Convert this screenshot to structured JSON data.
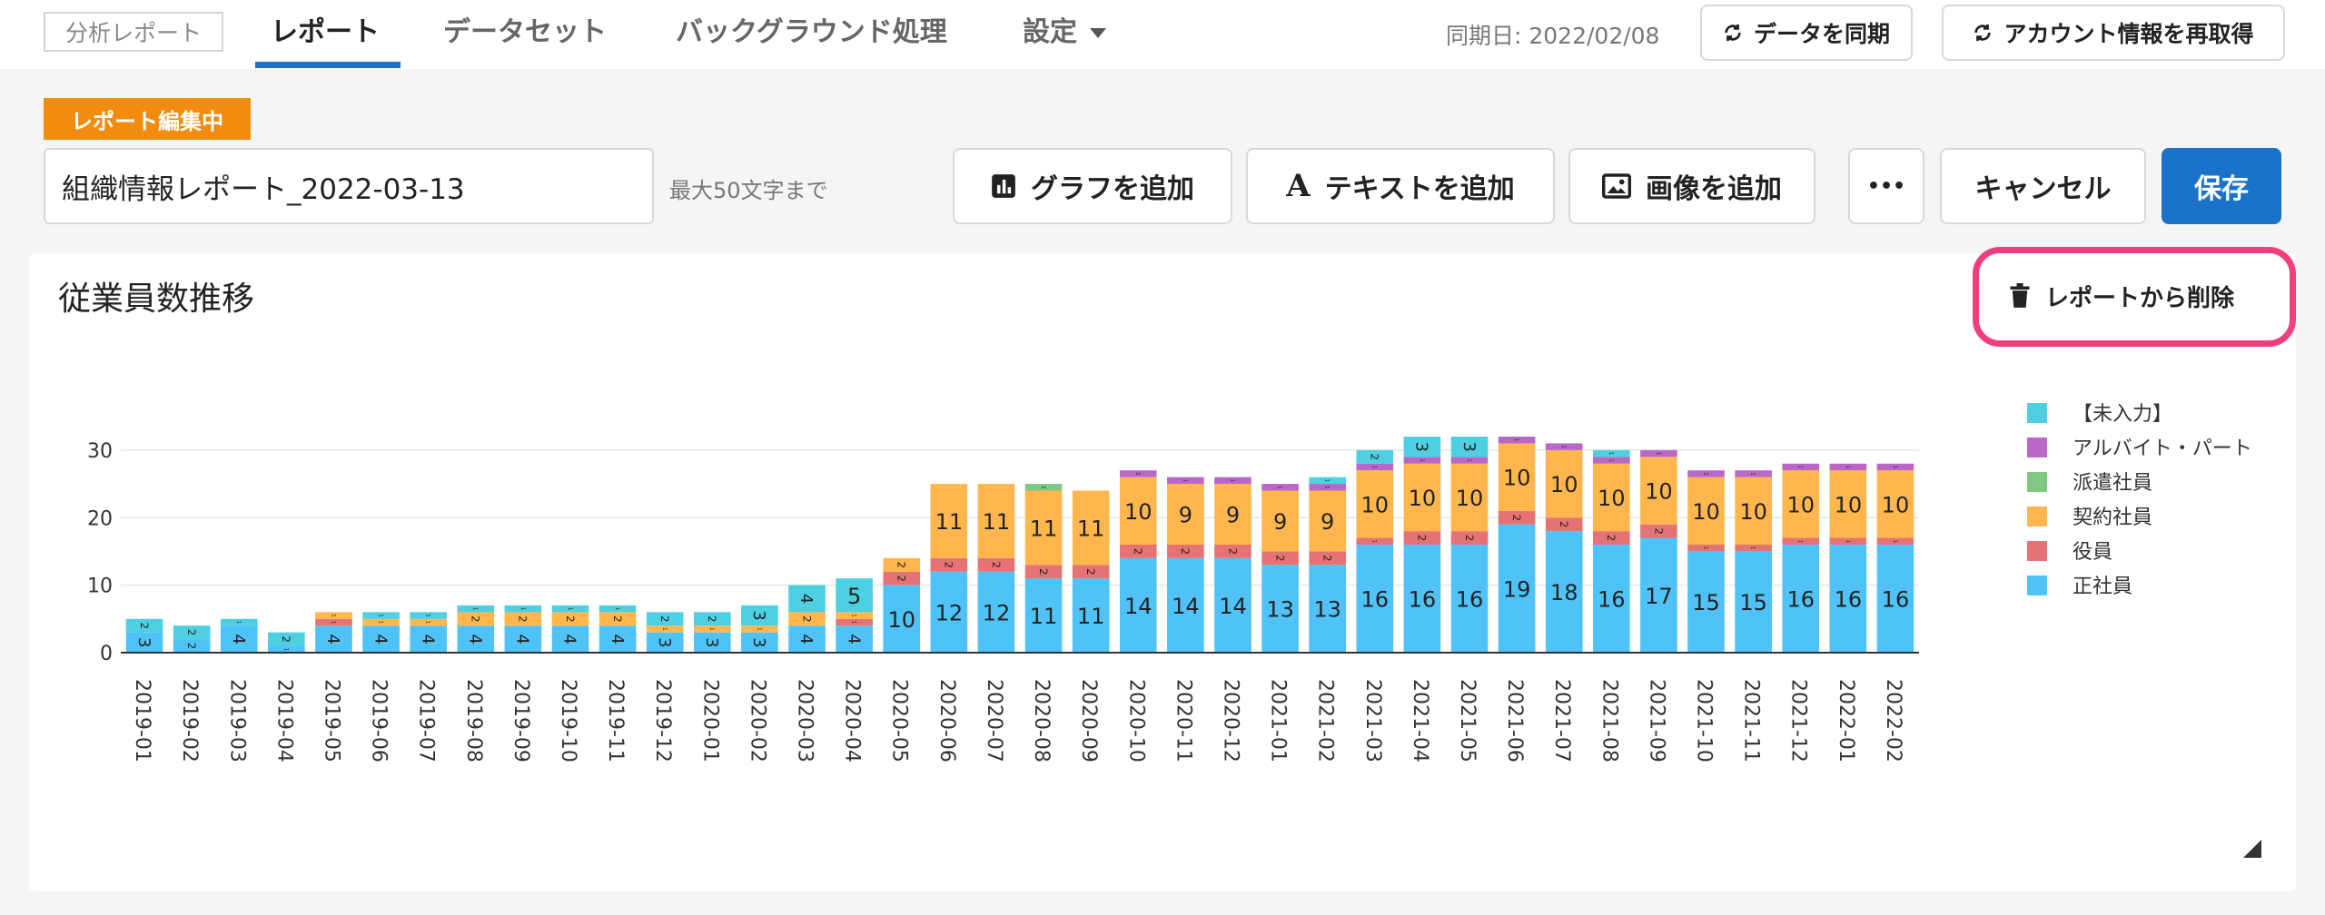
{
  "topbar": {
    "brand": "分析レポート",
    "tabs": [
      "レポート",
      "データセット",
      "バックグラウンド処理",
      "設定"
    ],
    "sync_date": "同期日: 2022/02/08",
    "sync_button": "データを同期",
    "reacquire_button": "アカウント情報を再取得"
  },
  "editor": {
    "badge": "レポート編集中",
    "title_value": "組織情報レポート_2022-03-13",
    "hint": "最大50文字まで",
    "add_graph": "グラフを追加",
    "add_text": "テキストを追加",
    "add_image": "画像を追加",
    "more": "•••",
    "cancel": "キャンセル",
    "save": "保存"
  },
  "card": {
    "title": "従業員数推移",
    "delete_button": "レポートから削除"
  },
  "colors": {
    "accent": "#1a73c8",
    "badge": "#f28c0f",
    "highlight": "#ef3f7e"
  },
  "chart_data": {
    "type": "bar",
    "stacked": true,
    "categories": [
      "2019-01",
      "2019-02",
      "2019-03",
      "2019-04",
      "2019-05",
      "2019-06",
      "2019-07",
      "2019-08",
      "2019-09",
      "2019-10",
      "2019-11",
      "2019-12",
      "2020-01",
      "2020-02",
      "2020-03",
      "2020-04",
      "2020-05",
      "2020-06",
      "2020-07",
      "2020-08",
      "2020-09",
      "2020-10",
      "2020-11",
      "2020-12",
      "2021-01",
      "2021-02",
      "2021-03",
      "2021-04",
      "2021-05",
      "2021-06",
      "2021-07",
      "2021-08",
      "2021-09",
      "2021-10",
      "2021-11",
      "2021-12",
      "2022-01",
      "2022-02"
    ],
    "ylim": [
      0,
      32
    ],
    "yticks": [
      0,
      10,
      20,
      30
    ],
    "grid": true,
    "legend_position": "right",
    "series": [
      {
        "name": "正社員",
        "color": "#4fc3f7",
        "values": [
          3,
          2,
          4,
          1,
          4,
          4,
          4,
          4,
          4,
          4,
          4,
          3,
          3,
          3,
          4,
          4,
          10,
          12,
          12,
          11,
          11,
          14,
          14,
          14,
          13,
          13,
          16,
          16,
          16,
          19,
          18,
          16,
          17,
          15,
          15,
          16,
          16,
          16
        ]
      },
      {
        "name": "役員",
        "color": "#e57373",
        "values": [
          0,
          0,
          0,
          0,
          1,
          0,
          0,
          0,
          0,
          0,
          0,
          0,
          0,
          0,
          0,
          1,
          2,
          2,
          2,
          2,
          2,
          2,
          2,
          2,
          2,
          2,
          1,
          2,
          2,
          2,
          2,
          2,
          2,
          1,
          1,
          1,
          1,
          1
        ]
      },
      {
        "name": "契約社員",
        "color": "#ffb74d",
        "values": [
          0,
          0,
          0,
          0,
          1,
          1,
          1,
          2,
          2,
          2,
          2,
          1,
          1,
          1,
          2,
          1,
          2,
          11,
          11,
          11,
          11,
          10,
          9,
          9,
          9,
          9,
          10,
          10,
          10,
          10,
          10,
          10,
          10,
          10,
          10,
          10,
          10,
          10
        ]
      },
      {
        "name": "派遣社員",
        "color": "#81c784",
        "values": [
          0,
          0,
          0,
          0,
          0,
          0,
          0,
          0,
          0,
          0,
          0,
          0,
          0,
          0,
          0,
          0,
          0,
          0,
          0,
          1,
          0,
          0,
          0,
          0,
          0,
          0,
          0,
          0,
          0,
          0,
          0,
          0,
          0,
          0,
          0,
          0,
          0,
          0
        ]
      },
      {
        "name": "アルバイト・パート",
        "color": "#ba68c8",
        "values": [
          0,
          0,
          0,
          0,
          0,
          0,
          0,
          0,
          0,
          0,
          0,
          0,
          0,
          0,
          0,
          0,
          0,
          0,
          0,
          0,
          0,
          1,
          1,
          1,
          1,
          1,
          1,
          1,
          1,
          1,
          1,
          1,
          1,
          1,
          1,
          1,
          1,
          1
        ]
      },
      {
        "name": "【未入力】",
        "color": "#4dd0e1",
        "values": [
          2,
          2,
          1,
          2,
          0,
          1,
          1,
          1,
          1,
          1,
          1,
          2,
          2,
          3,
          4,
          5,
          0,
          0,
          0,
          0,
          0,
          0,
          0,
          0,
          0,
          1,
          2,
          3,
          3,
          0,
          0,
          1,
          0,
          0,
          0,
          0,
          0,
          0
        ]
      }
    ],
    "legend_order": [
      "【未入力】",
      "アルバイト・パート",
      "派遣社員",
      "契約社員",
      "役員",
      "正社員"
    ]
  }
}
